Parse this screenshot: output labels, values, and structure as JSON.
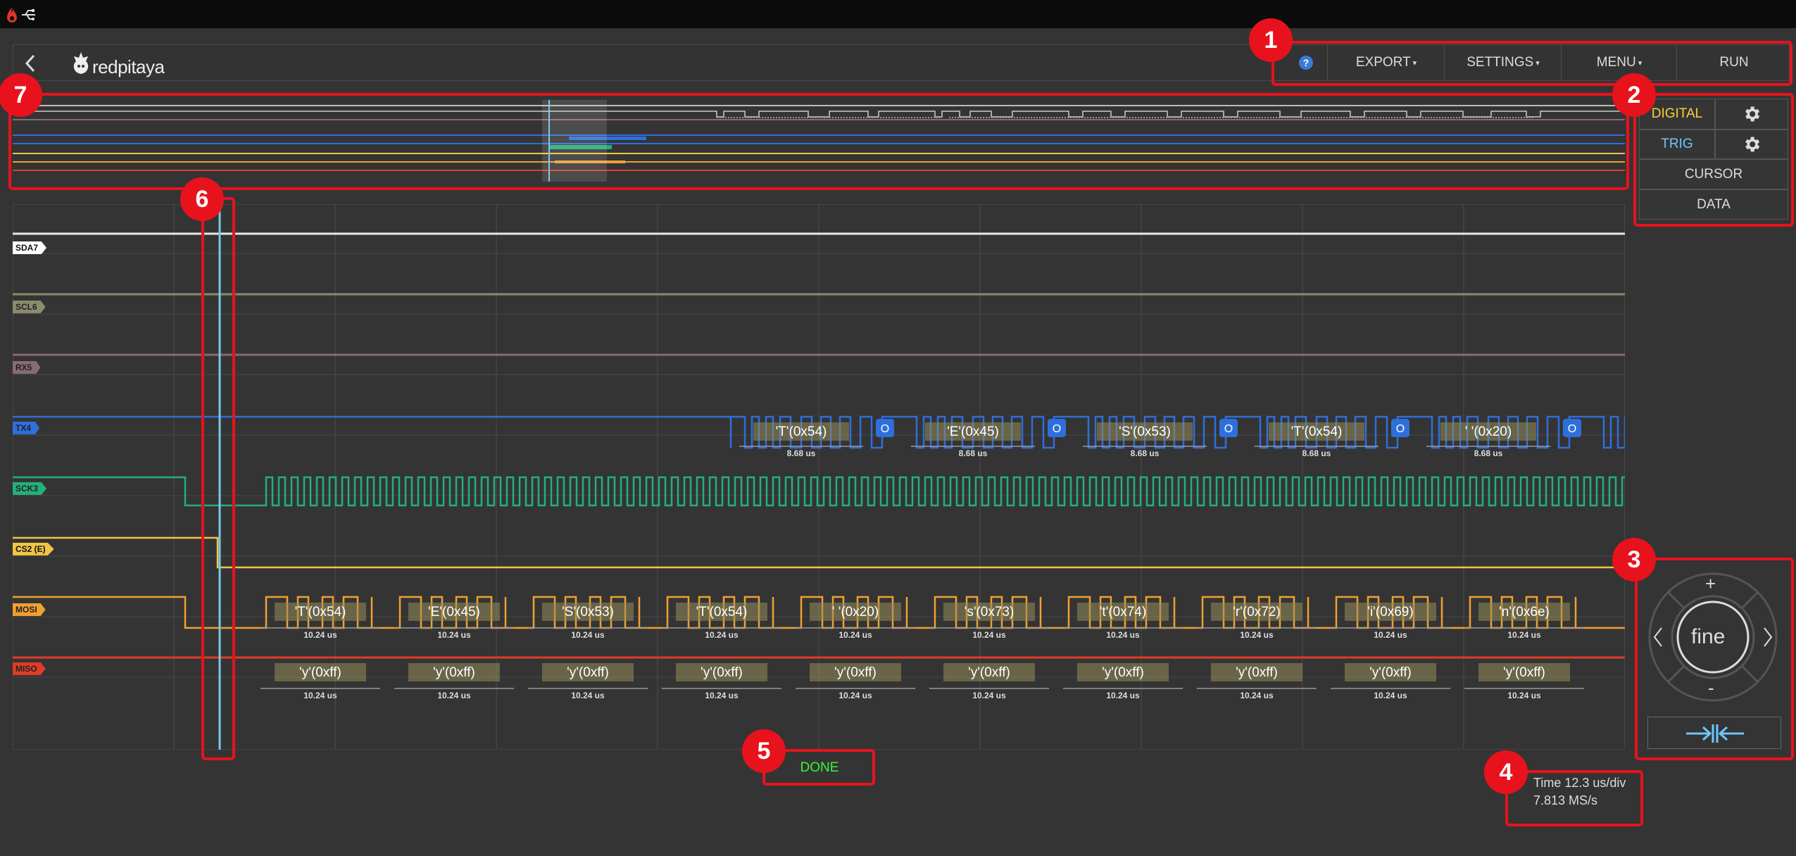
{
  "header": {
    "back_icon": "chevron-left-icon",
    "logo_text": "redpitaya",
    "help_label": "?",
    "export_label": "EXPORT",
    "settings_label": "SETTINGS",
    "menu_label": "MENU",
    "run_label": "RUN"
  },
  "side_panel": {
    "digital_label": "DIGITAL",
    "trig_label": "TRIG",
    "cursor_label": "CURSOR",
    "data_label": "DATA"
  },
  "channels": [
    {
      "name": "SDA7",
      "color": "#ffffff"
    },
    {
      "name": "SCL6",
      "color": "#8b8b6e"
    },
    {
      "name": "RX5",
      "color": "#8a6a72"
    },
    {
      "name": "TX4",
      "color": "#2f6fdc"
    },
    {
      "name": "SCK3",
      "color": "#22b07c"
    },
    {
      "name": "CS2 (E)",
      "color": "#f0c542"
    },
    {
      "name": "MOSI",
      "color": "#f0a030"
    },
    {
      "name": "MISO",
      "color": "#e03c28"
    }
  ],
  "decode": {
    "tx4": {
      "bytes": [
        "'T'(0x54)",
        "'E'(0x45)",
        "'S'(0x53)",
        "'T'(0x54)",
        "' '(0x20)"
      ],
      "marker": "O",
      "duration": "8.68 us"
    },
    "mosi": {
      "bytes": [
        "'T'(0x54)",
        "'E'(0x45)",
        "'S'(0x53)",
        "'T'(0x54)",
        "' '(0x20)",
        "'s'(0x73)",
        "'t'(0x74)",
        "'r'(0x72)",
        "'i'(0x69)",
        "'n'(0x6e)"
      ],
      "duration": "10.24 us"
    },
    "miso": {
      "bytes": [
        "'y'(0xff)",
        "'y'(0xff)",
        "'y'(0xff)",
        "'y'(0xff)",
        "'y'(0xff)",
        "'y'(0xff)",
        "'y'(0xff)",
        "'y'(0xff)",
        "'y'(0xff)",
        "'y'(0xff)"
      ],
      "duration": "10.24 us"
    }
  },
  "navigation": {
    "plus": "+",
    "minus": "-",
    "center": "fine",
    "fit_icon": "zoom-fit-icon"
  },
  "status": "DONE",
  "time_info": {
    "time_div": "Time 12.3 us/div",
    "sample_rate": "7.813 MS/s"
  },
  "annotations": [
    "1",
    "2",
    "3",
    "4",
    "5",
    "6",
    "7"
  ],
  "colors": {
    "accent_red": "#e8121c",
    "done_green": "#3ef23e",
    "digital_yellow": "#f5d23c",
    "trig_blue": "#6ec6ff"
  }
}
